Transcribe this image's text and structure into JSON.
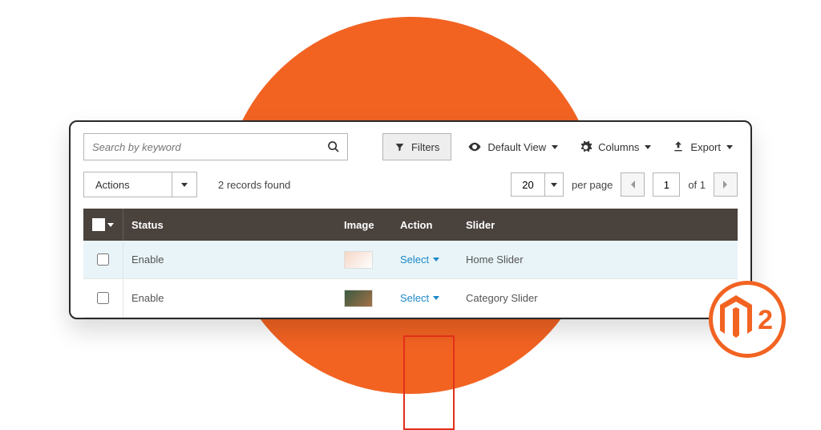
{
  "search": {
    "placeholder": "Search by keyword"
  },
  "toolbar": {
    "filters": "Filters",
    "defaultView": "Default View",
    "columns": "Columns",
    "export": "Export"
  },
  "actions": {
    "label": "Actions"
  },
  "recordsFound": "2 records found",
  "pagination": {
    "perPageValue": "20",
    "perPageLabel": "per page",
    "page": "1",
    "ofLabel": "of 1"
  },
  "columns": {
    "status": "Status",
    "image": "Image",
    "action": "Action",
    "slider": "Slider"
  },
  "rows": [
    {
      "status": "Enable",
      "action": "Select",
      "slider": "Home Slider"
    },
    {
      "status": "Enable",
      "action": "Select",
      "slider": "Category Slider"
    }
  ],
  "logo": {
    "text": "2"
  }
}
